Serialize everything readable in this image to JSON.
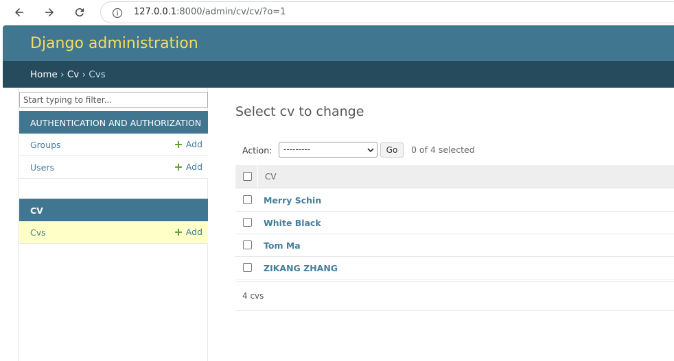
{
  "browser": {
    "url_host": "127.0.0.1",
    "url_rest": ":8000/admin/cv/cv/?o=1"
  },
  "header": {
    "brand": "Django administration"
  },
  "breadcrumbs": {
    "home": "Home",
    "app": "Cv",
    "current": "Cvs",
    "separator": "›"
  },
  "sidebar": {
    "filter_placeholder": "Start typing to filter...",
    "modules": [
      {
        "caption": "AUTHENTICATION AND AUTHORIZATION",
        "models": [
          {
            "label": "Groups",
            "add": "Add"
          },
          {
            "label": "Users",
            "add": "Add"
          }
        ]
      },
      {
        "caption": "CV",
        "models": [
          {
            "label": "Cvs",
            "add": "Add"
          }
        ]
      }
    ]
  },
  "content": {
    "title": "Select cv to change",
    "action_label": "Action:",
    "action_selected": "---------",
    "go_label": "Go",
    "selected_count": "0 of 4 selected",
    "column_header": "CV",
    "rows": [
      "Merry Schin",
      "White Black",
      "Tom Ma",
      "ZIKANG ZHANG"
    ],
    "paginator": "4 cvs"
  }
}
